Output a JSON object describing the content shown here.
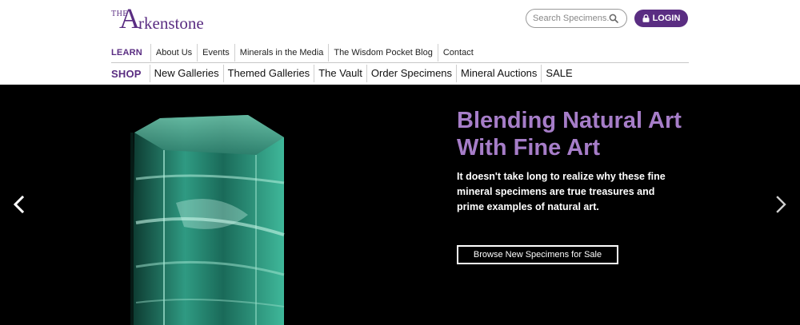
{
  "logo": {
    "the": "THE",
    "initial": "A",
    "rest": "rkenstone"
  },
  "search": {
    "placeholder": "Search Specimens..."
  },
  "login": {
    "label": "LOGIN"
  },
  "learn_nav": {
    "heading": "LEARN",
    "items": [
      "About Us",
      "Events",
      "Minerals in the Media",
      "The Wisdom Pocket Blog",
      "Contact"
    ]
  },
  "shop_nav": {
    "heading": "SHOP",
    "items": [
      "New Galleries",
      "Themed Galleries",
      "The Vault",
      "Order Specimens",
      "Mineral Auctions",
      "SALE"
    ]
  },
  "hero": {
    "title": "Blending Natural Art With Fine Art",
    "description": "It doesn't take long to realize why these fine mineral specimens are true treasures and prime examples of natural art.",
    "button": "Browse New Specimens for Sale"
  },
  "colors": {
    "brand": "#5a2d82",
    "hero_title": "#a67dc8",
    "hero_bg": "#000000"
  },
  "icons": [
    "search-icon",
    "lock-icon",
    "chevron-left-icon",
    "chevron-right-icon"
  ]
}
